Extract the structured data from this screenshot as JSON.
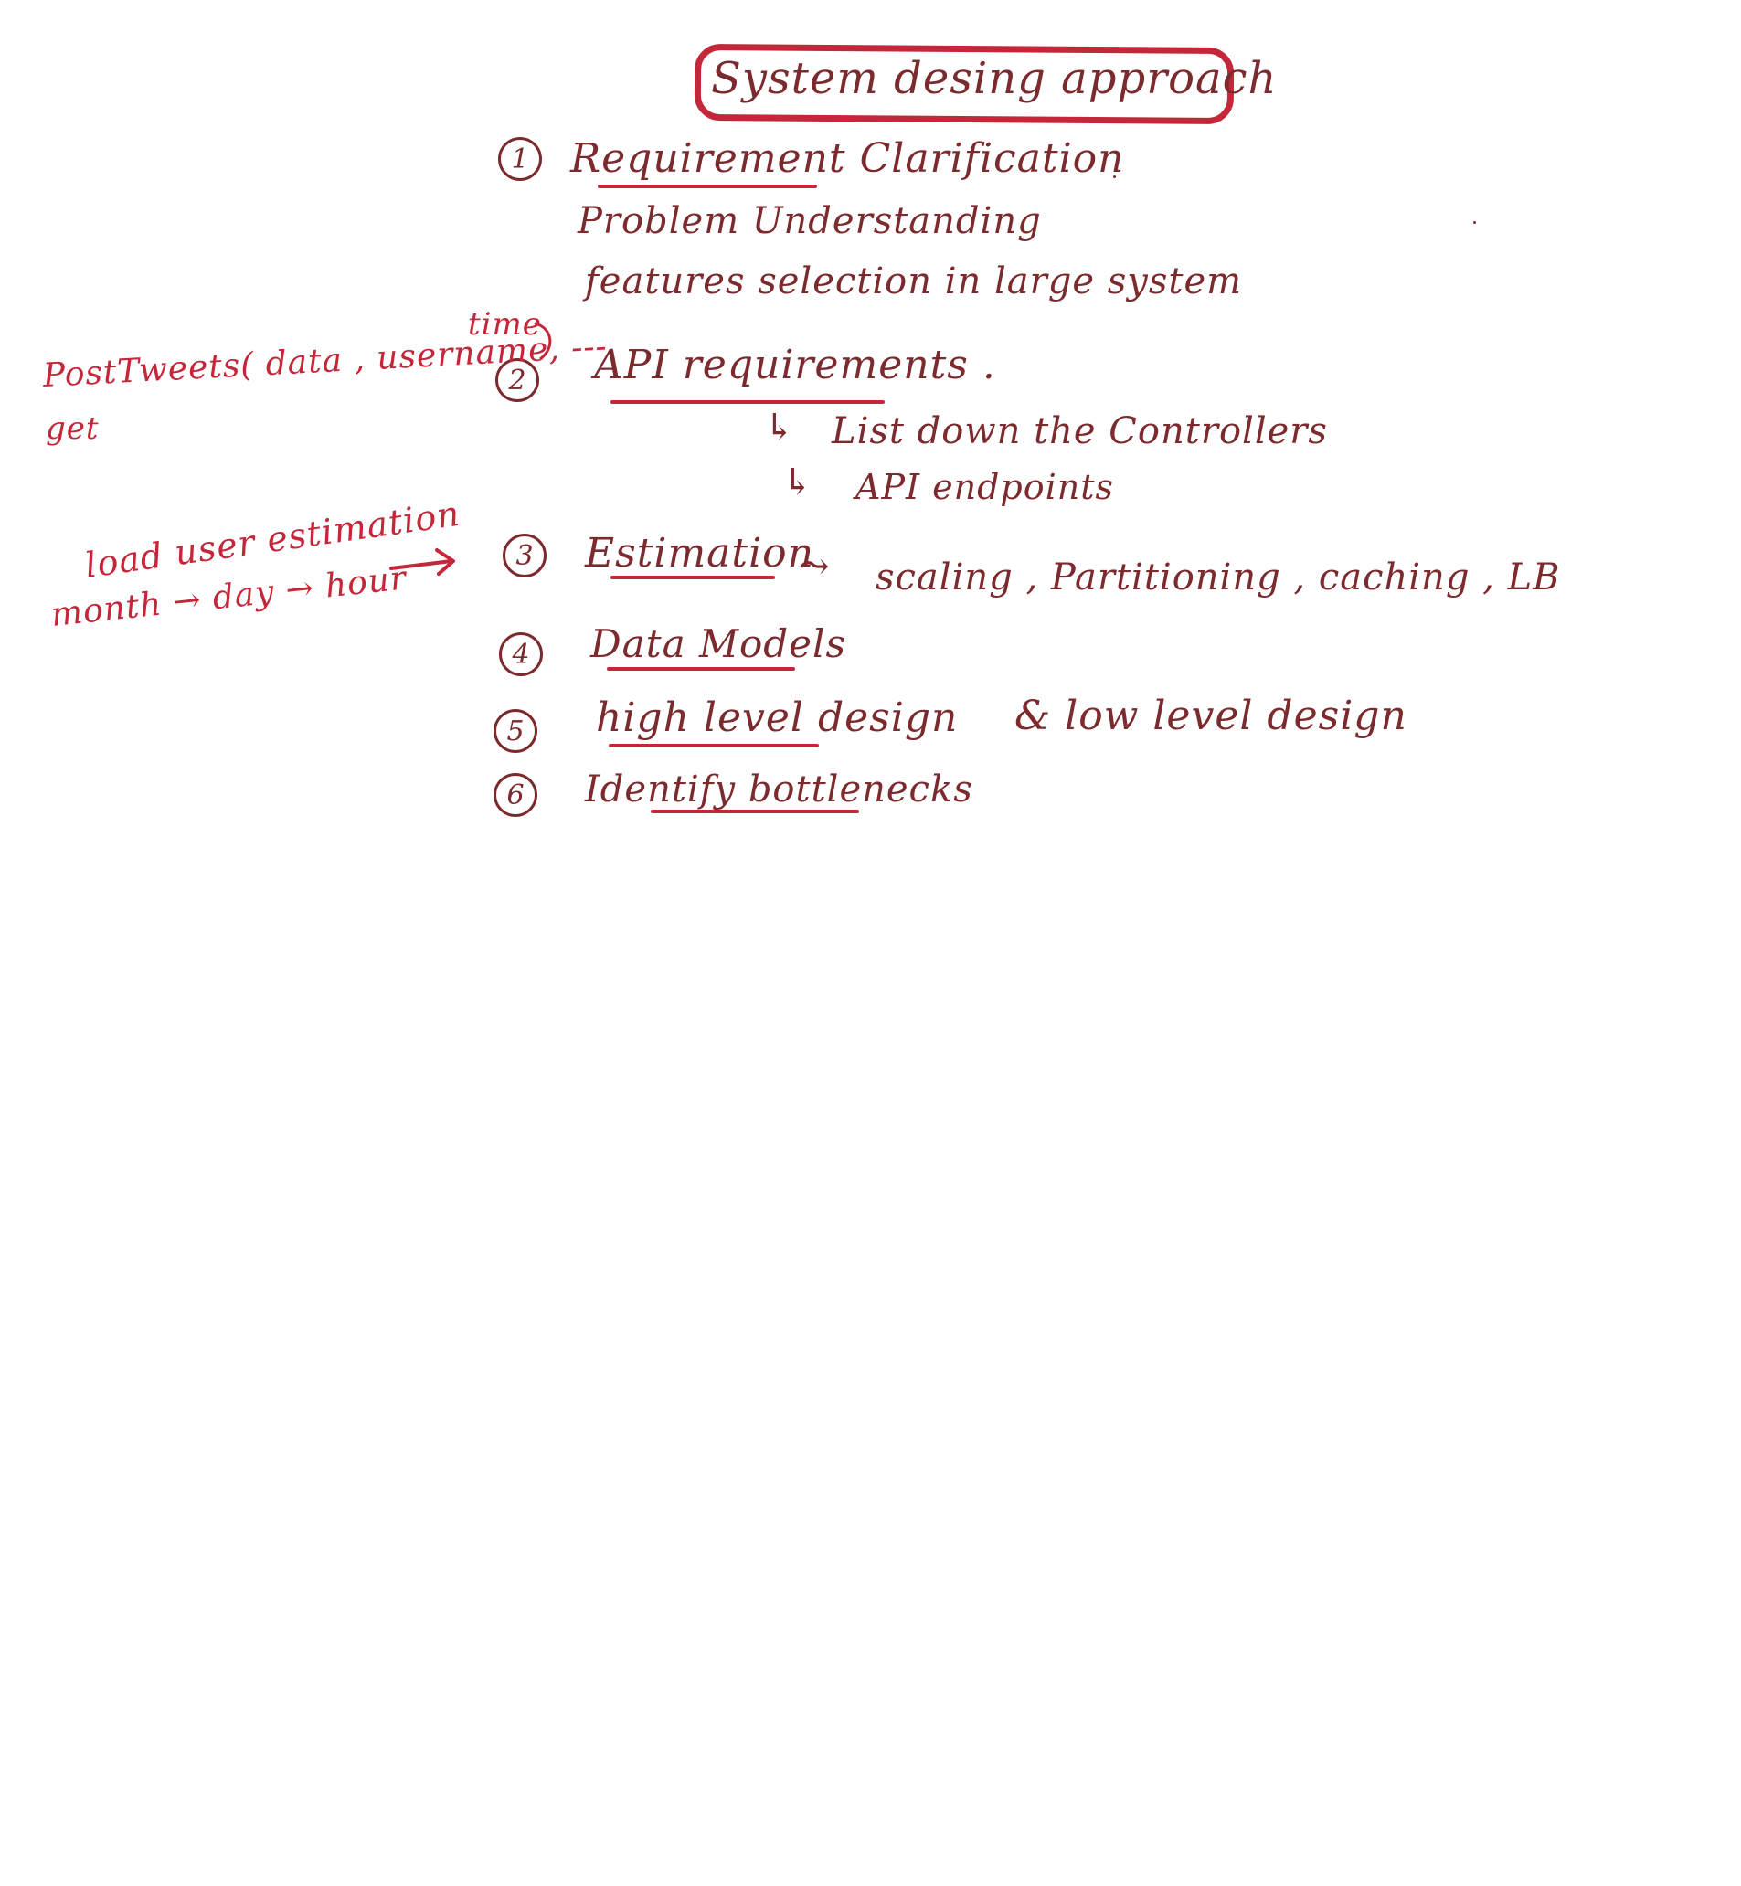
{
  "title": "System desing approach",
  "steps": [
    {
      "number": "1",
      "heading": "Requirement Clarification",
      "lines": [
        "Problem Understanding",
        "features selection in large system"
      ]
    },
    {
      "number": "2",
      "heading": "API requirements .",
      "sub_items": [
        "List down the Controllers",
        "API endpoints"
      ]
    },
    {
      "number": "3",
      "heading": "Estimation",
      "detail": "scaling , Partitioning , caching , LB"
    },
    {
      "number": "4",
      "heading": "Data Models"
    },
    {
      "number": "5",
      "heading": "high level design",
      "detail": "& low level design"
    },
    {
      "number": "6",
      "heading": "Identify bottlenecks"
    }
  ],
  "annotations": {
    "api_note_line1": "PostTweets( data , username, ---",
    "api_note_time": "time",
    "api_note_line2": "get",
    "estimation_note_line1": "load user estimation",
    "estimation_note_line2": "month → day → hour"
  },
  "colors": {
    "ink": "#7b2a2d",
    "highlight": "#c4273a",
    "background": "#ffffff"
  }
}
